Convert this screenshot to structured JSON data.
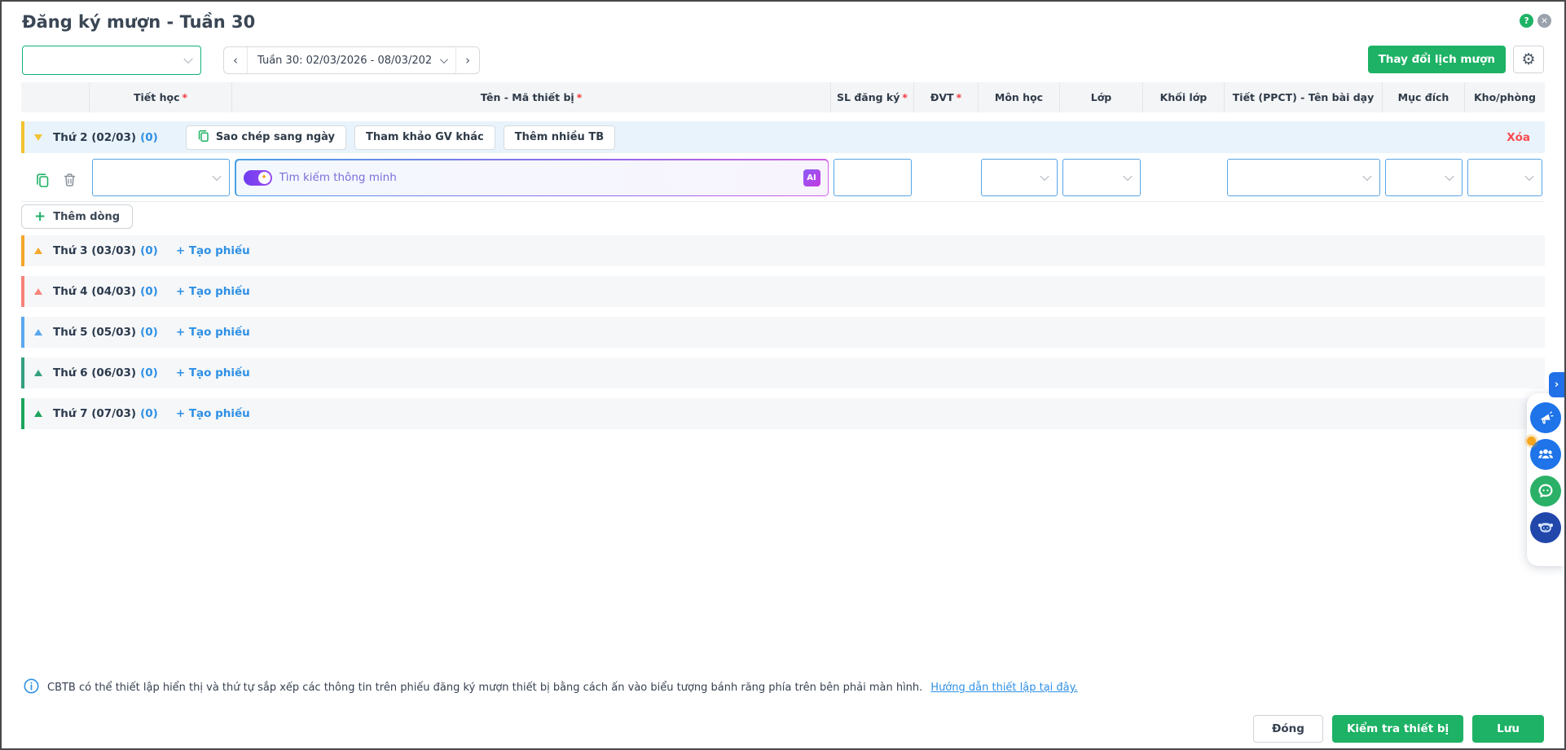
{
  "window": {
    "title": "Đăng ký mượn - Tuần 30"
  },
  "icons": {
    "help": "?",
    "close": "✕",
    "prev_week": "‹",
    "next_week": "›",
    "gear": "⚙",
    "plus": "+",
    "sparkle": "✦",
    "expand_chevron": "›",
    "info": "i",
    "ai_badge": "AI"
  },
  "toolbar": {
    "teacher_select_value": "",
    "week_label": "Tuần 30: 02/03/2026 - 08/03/202",
    "change_schedule_button": "Thay đổi lịch mượn"
  },
  "table": {
    "columns": [
      {
        "label": ""
      },
      {
        "label": "Tiết học",
        "star": "*"
      },
      {
        "label": "Tên - Mã thiết bị",
        "star": "*"
      },
      {
        "label": "SL đăng ký",
        "star": "*"
      },
      {
        "label": "ĐVT",
        "star": "*"
      },
      {
        "label": "Môn học"
      },
      {
        "label": "Lớp"
      },
      {
        "label": "Khối lớp"
      },
      {
        "label": "Tiết (PPCT) - Tên bài dạy"
      },
      {
        "label": "Mục đích"
      },
      {
        "label": "Kho/phòng"
      }
    ]
  },
  "day_groups": {
    "monday": {
      "label": "Thứ 2 (02/03)",
      "count": "(0)",
      "accent": "#f2c230",
      "copy_day_button": "Sao chép sang ngày",
      "ref_teacher_button": "Tham khảo GV khác",
      "add_many_button": "Thêm nhiều TB",
      "delete_label": "Xóa"
    },
    "rows": [
      {
        "label": "Thứ 3 (03/03)",
        "count": "(0)",
        "action": "+ Tạo phiếu",
        "accent": "#f5a62c"
      },
      {
        "label": "Thứ 4 (04/03)",
        "count": "(0)",
        "action": "+ Tạo phiếu",
        "accent": "#f9837b"
      },
      {
        "label": "Thứ 5 (05/03)",
        "count": "(0)",
        "action": "+ Tạo phiếu",
        "accent": "#5aa7f0"
      },
      {
        "label": "Thứ 6 (06/03)",
        "count": "(0)",
        "action": "+ Tạo phiếu",
        "accent": "#33a07e"
      },
      {
        "label": "Thứ 7 (07/03)",
        "count": "(0)",
        "action": "+ Tạo phiếu",
        "accent": "#1ca65b"
      }
    ]
  },
  "entry_row": {
    "smart_search_placeholder": "Tìm kiếm thông minh",
    "sl_value": ""
  },
  "add_row_button": "Thêm dòng",
  "footer": {
    "info_text": "CBTB có thể thiết lập hiển thị và thứ tự sắp xếp các thông tin trên phiếu đăng ký mượn thiết bị bằng cách ấn vào biểu tượng bánh răng phía trên bên phải màn hình.",
    "info_link": "Hướng dẫn thiết lập tại đây.",
    "close_button": "Đóng",
    "check_button": "Kiểm tra thiết bị",
    "save_button": "Lưu"
  },
  "colors": {
    "primary_green": "#1db265",
    "link_blue": "#2e90e5",
    "danger_red": "#fa4a4e",
    "input_border_blue": "#57a5e7",
    "select_border_green": "#10b07e"
  }
}
